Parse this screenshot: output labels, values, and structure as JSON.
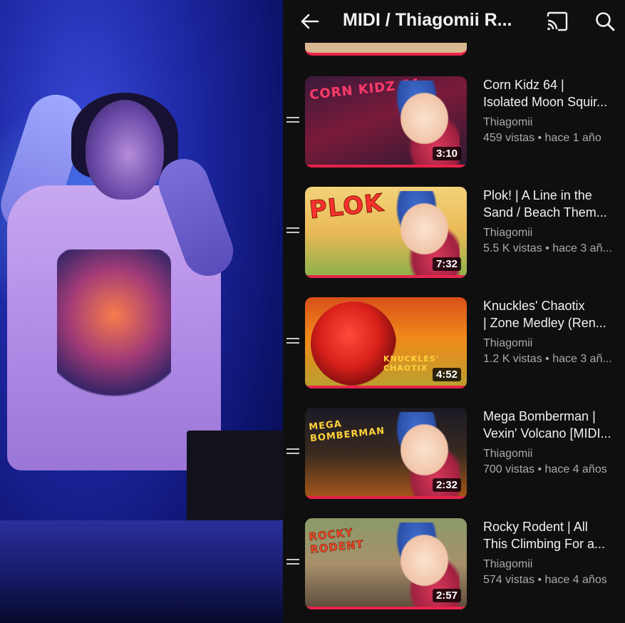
{
  "header": {
    "title": "MIDI / Thiagomii R...",
    "back_icon": "arrow-left-icon",
    "cast_icon": "cast-icon",
    "search_icon": "search-icon"
  },
  "colors": {
    "background": "#0f0f0f",
    "progress_red": "#e8234a",
    "text_primary": "#f1f1f1",
    "text_secondary": "#aaaaaa"
  },
  "videos": [
    {
      "title_line1": "Corn Kidz 64 |",
      "title_line2": "Isolated Moon Squir...",
      "channel": "Thiagomii",
      "meta": "459 vistas • hace 1 año",
      "duration": "3:10",
      "thumb_text": "CORN KIDZ 64"
    },
    {
      "title_line1": "Plok! | A Line in the",
      "title_line2": "Sand / Beach Them...",
      "channel": "Thiagomii",
      "meta": "5.5 K vistas • hace 3 añ...",
      "duration": "7:32",
      "thumb_text": "PLOK"
    },
    {
      "title_line1": "Knuckles' Chaotix",
      "title_line2": "| Zone Medley (Ren...",
      "channel": "Thiagomii",
      "meta": "1.2 K vistas • hace 3 añ...",
      "duration": "4:52",
      "thumb_text": "KNUCKLES' CHAOTIX"
    },
    {
      "title_line1": "Mega Bomberman |",
      "title_line2": "Vexin' Volcano [MIDI...",
      "channel": "Thiagomii",
      "meta": "700 vistas • hace 4 años",
      "duration": "2:32",
      "thumb_text": "MEGA BOMBERMAN"
    },
    {
      "title_line1": "Rocky Rodent | All",
      "title_line2": "This Climbing For a...",
      "channel": "Thiagomii",
      "meta": "574 vistas • hace 4 años",
      "duration": "2:57",
      "thumb_text": "ROCKY RODENT"
    }
  ]
}
